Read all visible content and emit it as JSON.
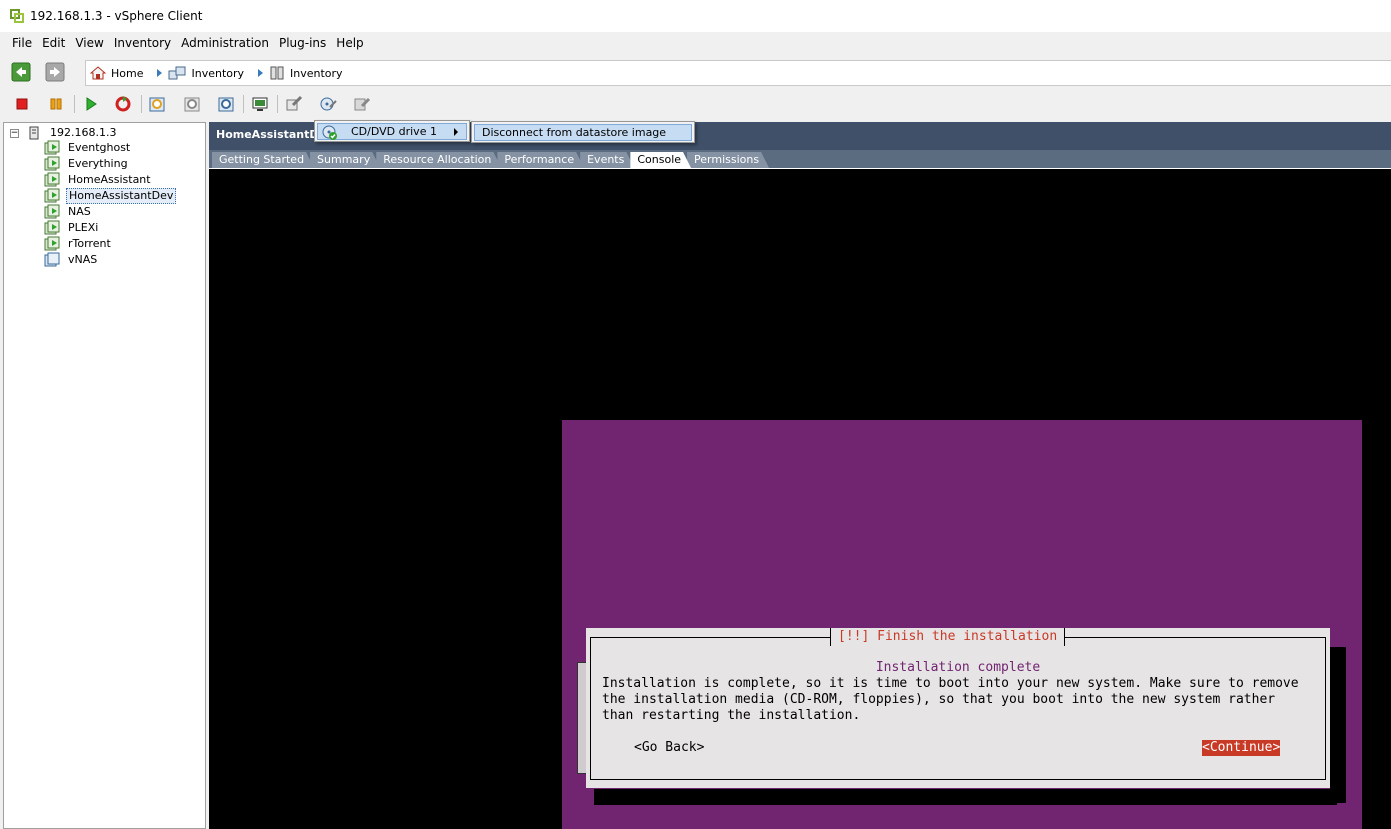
{
  "window": {
    "title": "192.168.1.3 - vSphere Client"
  },
  "menu": [
    "File",
    "Edit",
    "View",
    "Inventory",
    "Administration",
    "Plug-ins",
    "Help"
  ],
  "breadcrumb": [
    "Home",
    "Inventory",
    "Inventory"
  ],
  "toolbar": {
    "icons": [
      "stop-icon",
      "pause-icon",
      "play-icon",
      "reset-icon",
      "snapshot-icon",
      "revert-snapshot-icon",
      "snapshot-manager-icon",
      "console-icon",
      "edit-settings-icon",
      "cd-dvd-icon",
      "floppy-icon"
    ]
  },
  "tree": {
    "host": "192.168.1.3",
    "toggle": "−",
    "vms": [
      {
        "name": "Eventghost",
        "state": "running"
      },
      {
        "name": "Everything",
        "state": "running"
      },
      {
        "name": "HomeAssistant",
        "state": "running"
      },
      {
        "name": "HomeAssistantDev",
        "state": "running",
        "selected": true
      },
      {
        "name": "NAS",
        "state": "running"
      },
      {
        "name": "PLEXi",
        "state": "running"
      },
      {
        "name": "rTorrent",
        "state": "running"
      },
      {
        "name": "vNAS",
        "state": "stopped"
      }
    ]
  },
  "vm_panel": {
    "title": "HomeAssistantDe",
    "tabs": [
      "Getting Started",
      "Summary",
      "Resource Allocation",
      "Performance",
      "Events",
      "Console",
      "Permissions"
    ],
    "active_tab": "Console"
  },
  "context_menu": {
    "item": "CD/DVD drive 1",
    "submenu_item": "Disconnect from datastore image"
  },
  "installer": {
    "title": "[!!] Finish the installation",
    "subtitle": "Installation complete",
    "body_lines": [
      "Installation is complete, so it is time to boot into your new system. Make sure to remove",
      "the installation media (CD-ROM, floppies), so that you boot into the new system rather",
      "than restarting the installation."
    ],
    "back_button": "<Go Back>",
    "continue_button": "<Continue>"
  },
  "colors": {
    "console_bg": "#000000",
    "installer_bg": "#712570",
    "dialog_bg": "#e7e4e6",
    "accent_red": "#c83a26",
    "panel_header": "#3f5068",
    "menu_highlight": "#c6dcf2"
  }
}
